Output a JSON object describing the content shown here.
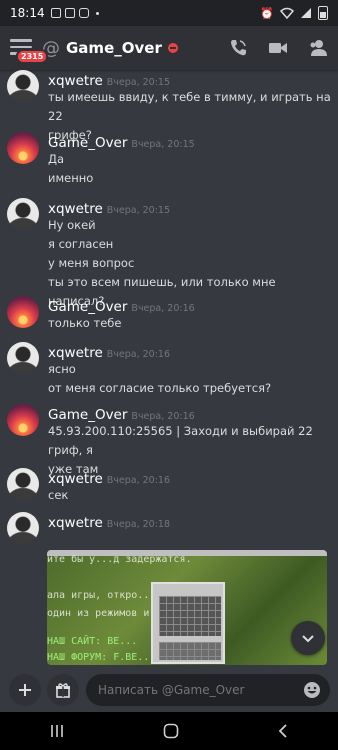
{
  "status_bar": {
    "time": "18:14"
  },
  "header": {
    "badge_count": "2315",
    "at_symbol": "@",
    "title": "Game_Over",
    "status": "do-not-disturb",
    "status_color": "#ed4245"
  },
  "messages": [
    {
      "author": "xqwetre",
      "avatar": "xqwetre-avatar",
      "time": "Вчера, 20:15",
      "lines": [
        "ты имеешь ввиду, к тебе в тимму, и играть на 22",
        "грифе?"
      ]
    },
    {
      "author": "Game_Over",
      "avatar": "game-over-avatar",
      "time": "Вчера, 20:15",
      "lines": [
        "Да",
        "именно"
      ]
    },
    {
      "author": "xqwetre",
      "avatar": "xqwetre-avatar",
      "time": "Вчера, 20:15",
      "lines": [
        "Ну окей",
        "я согласен",
        "у меня вопрос",
        "ты это всем пишешь, или только мне написал?"
      ]
    },
    {
      "author": "Game_Over",
      "avatar": "game-over-avatar",
      "time": "Вчера, 20:16",
      "lines": [
        "только тебе"
      ]
    },
    {
      "author": "xqwetre",
      "avatar": "xqwetre-avatar",
      "time": "Вчера, 20:16",
      "lines": [
        "ясно",
        "от меня согласие только требуется?"
      ]
    },
    {
      "author": "Game_Over",
      "avatar": "game-over-avatar",
      "time": "Вчера, 20:16",
      "lines": [
        "45.93.200.110:25565 | Заходи и выбирай 22 гриф, я",
        "уже там"
      ]
    },
    {
      "author": "xqwetre",
      "avatar": "xqwetre-avatar",
      "time": "Вчера, 20:16",
      "lines": [
        "сек"
      ]
    },
    {
      "author": "xqwetre",
      "avatar": "xqwetre-avatar",
      "time": "Вчера, 20:18",
      "lines": []
    }
  ],
  "attachment": {
    "kind": "image",
    "overlay_lines": [
      "ите бы у...д задержатся.",
      "ала игры, откро...компаса,",
      "один из режимов и...т на КРС",
      "НАШ САЙТ: ВЕ...",
      "НАШ ФОРУМ: F.ВЕ..."
    ]
  },
  "composer": {
    "placeholder": "Написать @Game_Over"
  },
  "colors": {
    "background": "#36393f",
    "header": "#2f3136",
    "input": "#202225",
    "badge": "#ed4245"
  }
}
